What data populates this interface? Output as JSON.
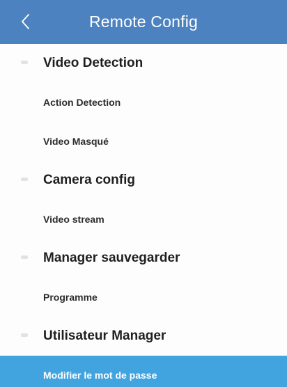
{
  "header": {
    "title": "Remote Config",
    "back_icon": "chevron-left-icon",
    "bg_color": "#4d82c0"
  },
  "menu": {
    "active_color": "#42a4df",
    "groups": [
      {
        "title": "Video Detection",
        "items": [
          "Action Detection",
          "Video Masqué"
        ]
      },
      {
        "title": "Camera config",
        "items": [
          "Video stream"
        ]
      },
      {
        "title": "Manager sauvegarder",
        "items": [
          "Programme"
        ]
      },
      {
        "title": "Utilisateur Manager",
        "items": [
          "Modifier le mot de passe"
        ]
      }
    ],
    "selected_item": "Modifier le mot de passe"
  }
}
